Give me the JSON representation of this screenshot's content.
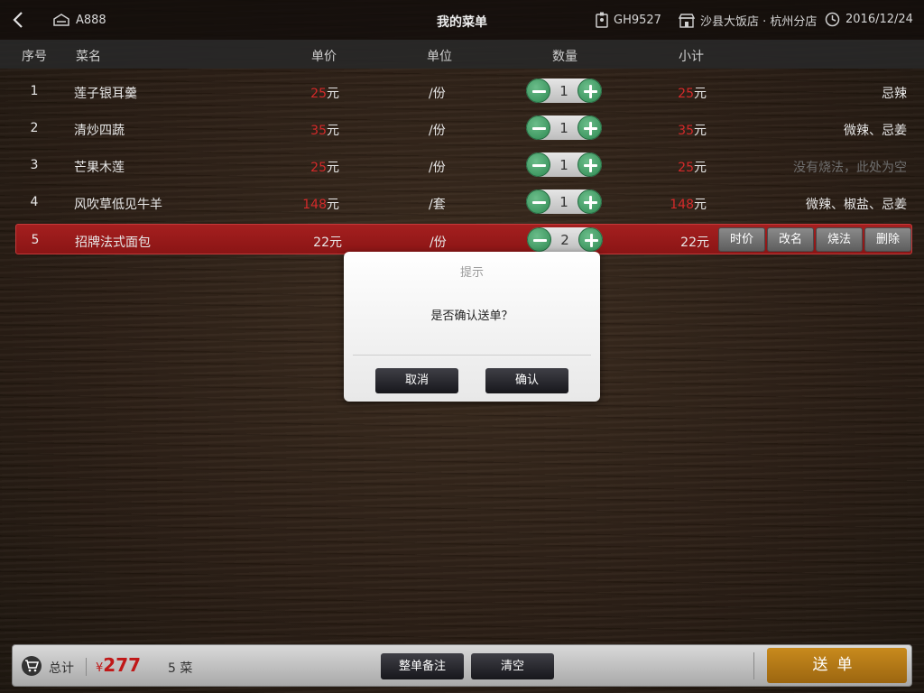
{
  "topbar": {
    "title": "我的菜单",
    "table_no": "A888",
    "waiter_id": "GH9527",
    "restaurant": "沙县大饭店 · 杭州分店",
    "date": "2016/12/24"
  },
  "columns": {
    "no": "序号",
    "name": "菜名",
    "price": "单价",
    "unit": "单位",
    "qty": "数量",
    "subtotal": "小计"
  },
  "currency_unit": "元",
  "rows": [
    {
      "no": "1",
      "name": "莲子银耳羹",
      "price": "25",
      "unit": "/份",
      "qty": "1",
      "subtotal": "25",
      "note": "忌辣"
    },
    {
      "no": "2",
      "name": "清炒四蔬",
      "price": "35",
      "unit": "/份",
      "qty": "1",
      "subtotal": "35",
      "note": "微辣、忌姜"
    },
    {
      "no": "3",
      "name": "芒果木莲",
      "price": "25",
      "unit": "/份",
      "qty": "1",
      "subtotal": "25",
      "note": "没有烧法，此处为空"
    },
    {
      "no": "4",
      "name": "风吹草低见牛羊",
      "price": "148",
      "unit": "/套",
      "qty": "1",
      "subtotal": "148",
      "note": "微辣、椒盐、忌姜"
    },
    {
      "no": "5",
      "name": "招牌法式面包",
      "price": "22",
      "unit": "/份",
      "qty": "2",
      "subtotal": "22",
      "note": ""
    }
  ],
  "row_actions": {
    "price": "时价",
    "rename": "改名",
    "cooking": "烧法",
    "delete": "删除"
  },
  "dialog": {
    "title": "提示",
    "message": "是否确认送单？",
    "cancel": "取消",
    "confirm": "确认"
  },
  "bottombar": {
    "total_label": "总计",
    "currency": "¥",
    "total": "277",
    "count": "5 菜",
    "order_note": "整单备注",
    "clear": "清空",
    "send": "送单"
  },
  "colors": {
    "accent_red": "#d42a2a",
    "stepper_green": "#3f9e64",
    "send_gold": "#b87a18",
    "selected_row": "#9a1a1a"
  }
}
